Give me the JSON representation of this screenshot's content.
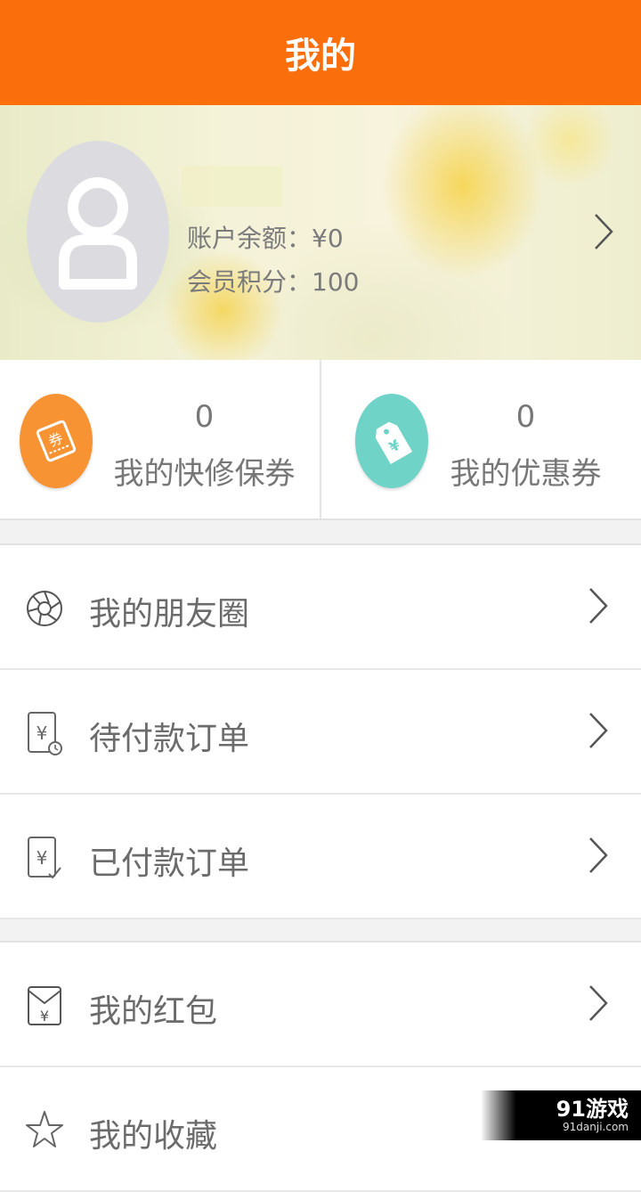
{
  "header": {
    "title": "我的"
  },
  "profile": {
    "balance": "账户余额：¥0",
    "points": "会员积分：100"
  },
  "coupons": [
    {
      "count": "0",
      "label": "我的快修保券",
      "icon_text": "券",
      "color": "#f79332"
    },
    {
      "count": "0",
      "label": "我的优惠券",
      "icon_text": "¥",
      "color": "#6fd3c7"
    }
  ],
  "menu_group1": [
    {
      "label": "我的朋友圈",
      "icon": "aperture-icon"
    },
    {
      "label": "待付款订单",
      "icon": "pending-order-icon"
    },
    {
      "label": "已付款订单",
      "icon": "paid-order-icon"
    }
  ],
  "menu_group2": [
    {
      "label": "我的红包",
      "icon": "red-envelope-icon"
    },
    {
      "label": "我的收藏",
      "icon": "star-icon"
    }
  ],
  "watermark": {
    "brand": "91游戏",
    "site": "91danji.com"
  },
  "colors": {
    "accent": "#fb6e0c"
  }
}
